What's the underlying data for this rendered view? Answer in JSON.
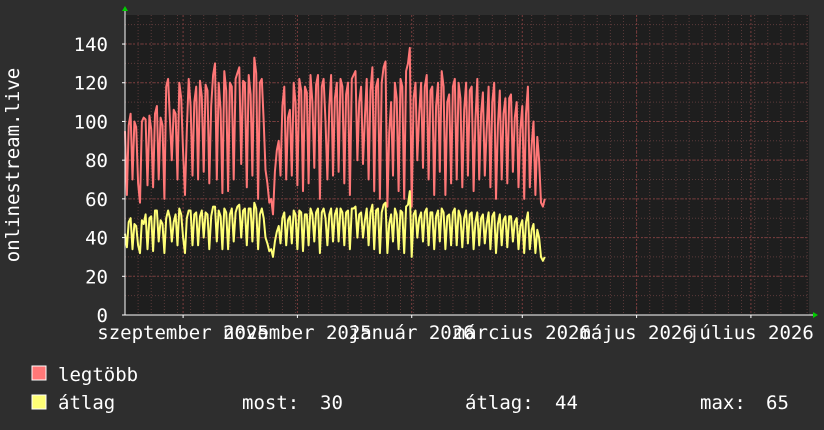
{
  "chart_data": {
    "type": "line",
    "ylabel": "onlinestream.live",
    "ylim": [
      0,
      155
    ],
    "yticks": [
      0,
      20,
      40,
      60,
      80,
      100,
      120,
      140
    ],
    "x_tick_labels": [
      "szeptember 2025",
      "november 2025",
      "január 2026",
      "március 2026",
      "május 2026",
      "július 2026"
    ],
    "x_range": [
      "2025-08-01",
      "2026-08-01"
    ],
    "x_tick_dates": [
      "2025-09-01",
      "2025-11-01",
      "2026-01-01",
      "2026-03-01",
      "2026-05-01",
      "2026-07-01"
    ],
    "grid": true,
    "colors": {
      "background": "#2e2e2e",
      "plot_background": "#1e1e1e",
      "grid": "#5a3a3a",
      "axis": "#ffffff",
      "arrow": "#00cc00",
      "max_series": "#ff7777",
      "avg_series": "#ffff77"
    },
    "series": [
      {
        "name": "legtöbb",
        "color": "#ff7777",
        "start": "2025-08-01",
        "interval_days": 1,
        "values": [
          95,
          62,
          98,
          104,
          70,
          100,
          97,
          68,
          58,
          100,
          102,
          101,
          67,
          103,
          96,
          66,
          104,
          108,
          70,
          102,
          98,
          60,
          118,
          122,
          100,
          80,
          106,
          104,
          70,
          120,
          112,
          84,
          62,
          95,
          122,
          108,
          72,
          110,
          118,
          70,
          121,
          113,
          74,
          119,
          116,
          68,
          108,
          124,
          130,
          70,
          120,
          106,
          63,
          126,
          116,
          64,
          120,
          118,
          70,
          122,
          125,
          128,
          78,
          121,
          120,
          66,
          124,
          114,
          72,
          133,
          125,
          60,
          120,
          122,
          100,
          75,
          68,
          58,
          60,
          52,
          74,
          85,
          90,
          72,
          108,
          118,
          70,
          102,
          106,
          72,
          120,
          110,
          67,
          122,
          116,
          64,
          118,
          115,
          68,
          124,
          110,
          76,
          119,
          124,
          60,
          118,
          122,
          100,
          70,
          108,
          124,
          72,
          112,
          120,
          74,
          122,
          118,
          68,
          114,
          120,
          62,
          122,
          124,
          126,
          80,
          110,
          118,
          78,
          102,
          122,
          70,
          116,
          128,
          64,
          118,
          122,
          60,
          120,
          128,
          131,
          56,
          94,
          110,
          72,
          120,
          112,
          64,
          122,
          118,
          60,
          126,
          130,
          138,
          56,
          112,
          120,
          80,
          104,
          120,
          76,
          118,
          124,
          70,
          116,
          118,
          62,
          108,
          120,
          74,
          126,
          118,
          62,
          110,
          114,
          68,
          118,
          122,
          70,
          120,
          112,
          66,
          106,
          120,
          72,
          116,
          118,
          64,
          100,
          122,
          70,
          104,
          115,
          72,
          96,
          118,
          66,
          110,
          120,
          60,
          98,
          116,
          70,
          104,
          112,
          68,
          112,
          114,
          74,
          102,
          110,
          66,
          96,
          108,
          60,
          104,
          118,
          66,
          88,
          100,
          62,
          92,
          80,
          58,
          56,
          60
        ]
      },
      {
        "name": "átlag",
        "color": "#ffff77",
        "start": "2025-08-01",
        "interval_days": 1,
        "values": [
          42,
          35,
          48,
          50,
          34,
          47,
          46,
          36,
          32,
          49,
          47,
          52,
          34,
          50,
          51,
          33,
          54,
          54,
          38,
          49,
          47,
          32,
          50,
          54,
          50,
          38,
          48,
          52,
          36,
          55,
          52,
          40,
          32,
          50,
          54,
          54,
          36,
          52,
          53,
          36,
          51,
          54,
          40,
          53,
          52,
          34,
          51,
          56,
          56,
          38,
          54,
          51,
          34,
          55,
          53,
          34,
          52,
          55,
          38,
          53,
          56,
          57,
          40,
          54,
          55,
          36,
          55,
          55,
          38,
          58,
          55,
          34,
          52,
          55,
          50,
          40,
          37,
          33,
          34,
          30,
          38,
          43,
          46,
          37,
          50,
          53,
          36,
          49,
          51,
          37,
          54,
          52,
          34,
          54,
          53,
          33,
          52,
          52,
          36,
          55,
          52,
          38,
          53,
          55,
          32,
          53,
          55,
          50,
          36,
          52,
          55,
          38,
          52,
          55,
          38,
          55,
          53,
          36,
          53,
          54,
          34,
          55,
          55,
          56,
          40,
          52,
          53,
          40,
          49,
          55,
          36,
          53,
          57,
          34,
          54,
          55,
          32,
          53,
          57,
          58,
          32,
          47,
          52,
          38,
          55,
          52,
          34,
          54,
          53,
          32,
          56,
          57,
          64,
          30,
          52,
          54,
          40,
          50,
          53,
          38,
          53,
          55,
          36,
          53,
          53,
          34,
          51,
          54,
          38,
          55,
          53,
          34,
          51,
          52,
          36,
          53,
          55,
          36,
          54,
          51,
          35,
          50,
          54,
          37,
          52,
          53,
          34,
          48,
          53,
          36,
          50,
          52,
          37,
          47,
          53,
          34,
          51,
          53,
          32,
          47,
          52,
          36,
          49,
          51,
          35,
          51,
          51,
          38,
          48,
          50,
          34,
          46,
          49,
          32,
          48,
          53,
          34,
          44,
          47,
          32,
          44,
          40,
          30,
          28,
          30
        ]
      }
    ],
    "legend": [
      {
        "label": "legtöbb",
        "color": "#ff7777"
      },
      {
        "label": "átlag",
        "color": "#ffff77"
      }
    ],
    "stats": {
      "most_label": "most:",
      "most_value": "30",
      "atlag_label": "átlag:",
      "atlag_value": "44",
      "max_label": "max:",
      "max_value": "65"
    }
  }
}
